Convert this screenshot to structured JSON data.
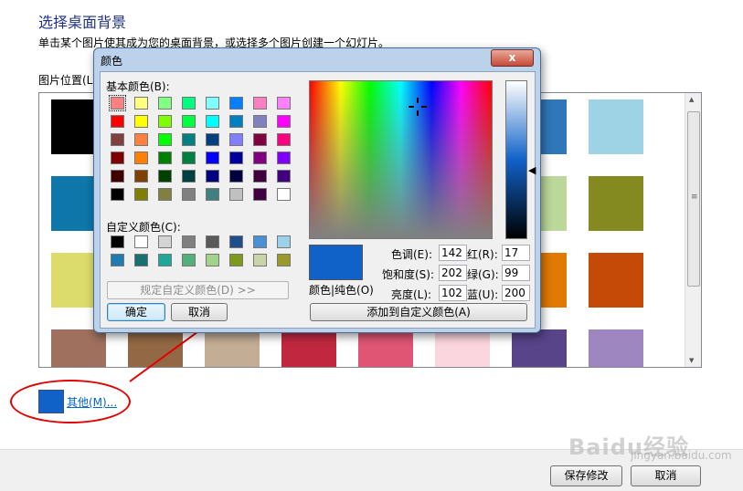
{
  "page": {
    "title": "选择桌面背景",
    "subtitle": "单击某个图片使其成为您的桌面背景，或选择多个图片创建一个幻灯片。",
    "picture_location_label": "图片位置(L)",
    "bg_swatches": [
      "#000000",
      "#1d63ad",
      "#2d62b7",
      "#15579e",
      "#b33d41",
      "#ae61a6",
      "#2f77b8",
      "#9ed3e6",
      "#0e76a8",
      "#1a92c4",
      "#12a3a3",
      "#1e8f55",
      "#4c9e45",
      "#7fb43b",
      "#bcd79a",
      "#848a20",
      "#dcdc6c",
      "#e7d04e",
      "#f0c44e",
      "#f0ab3a",
      "#f09622",
      "#ec7e1f",
      "#e07a05",
      "#c64a07",
      "#9e705d",
      "#926944",
      "#c3ad95",
      "#c12840",
      "#df5573",
      "#fcd6df",
      "#574489",
      "#9e87c1"
    ],
    "more_colors_link": "其他(M)...",
    "save_button": "保存修改",
    "cancel_button": "取消",
    "watermark": "Baidu经验",
    "watermark_url": "jingyan.baidu.com"
  },
  "dialog": {
    "title": "颜色",
    "close_symbol": "x",
    "basic_colors_label": "基本颜色(B):",
    "basic_colors": [
      [
        "#ff8080",
        "#ffff80",
        "#80ff80",
        "#00ff80",
        "#80ffff",
        "#0080ff",
        "#ff80c0",
        "#ff80ff"
      ],
      [
        "#ff0000",
        "#ffff00",
        "#80ff00",
        "#00ff40",
        "#00ffff",
        "#0080c0",
        "#8080c0",
        "#ff00ff"
      ],
      [
        "#804040",
        "#ff8040",
        "#00ff00",
        "#008080",
        "#004080",
        "#8080ff",
        "#800040",
        "#ff0080"
      ],
      [
        "#800000",
        "#ff8000",
        "#008000",
        "#008040",
        "#0000ff",
        "#0000a0",
        "#800080",
        "#8000ff"
      ],
      [
        "#400000",
        "#804000",
        "#004000",
        "#004040",
        "#000080",
        "#000040",
        "#400040",
        "#400080"
      ],
      [
        "#000000",
        "#808000",
        "#808040",
        "#808080",
        "#408080",
        "#c0c0c0",
        "#400040",
        "#ffffff"
      ]
    ],
    "custom_colors_label": "自定义颜色(C):",
    "custom_colors": [
      [
        "#000000",
        "#ffffff",
        "#d4d4d4",
        "#7f7f7f",
        "#595959",
        "#1f4e8c",
        "#4a90d6",
        "#9ad0e8"
      ],
      [
        "#1f7bb0",
        "#1a6f6f",
        "#1ea89a",
        "#54b07a",
        "#a3d38a",
        "#7e9a1c",
        "#c9d5a6",
        "#9a9a2a"
      ]
    ],
    "define_custom_button": "规定自定义颜色(D) >>",
    "ok_button": "确定",
    "cancel_button": "取消",
    "color_solid_label": "颜色|纯色(O)",
    "hue_label": "色调(E):",
    "hue_value": "142",
    "sat_label": "饱和度(S):",
    "sat_value": "202",
    "lum_label": "亮度(L):",
    "lum_value": "102",
    "red_label": "红(R):",
    "red_value": "17",
    "green_label": "绿(G):",
    "green_value": "99",
    "blue_label": "蓝(U):",
    "blue_value": "200",
    "add_to_custom_button": "添加到自定义颜色(A)",
    "current_color": "#1162c8"
  }
}
